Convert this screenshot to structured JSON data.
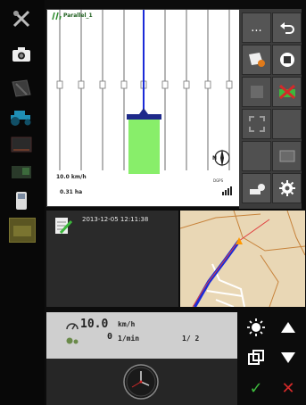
{
  "guidance": {
    "track_name": "Parallel_1",
    "speed": "10.0 km/h",
    "area": "0.31 ha",
    "gps_label": "DGPS",
    "compass_label": "N"
  },
  "job": {
    "timestamp": "2013-12-05 12:11:38"
  },
  "work": {
    "speed_value": "10.0",
    "speed_unit": "km/h",
    "rpm_value": "0",
    "rpm_unit": "1/min",
    "counter": "1/ 2"
  },
  "colors": {
    "guidance_line": "#1b2bd8",
    "worked_area": "#88ee6a",
    "implement": "#1e2a8a",
    "track_lines": "#6b6b6b",
    "confirm": "#3db83d",
    "cancel": "#d42a2a",
    "map_bg": "#e9d7b5",
    "map_path": "#2233dd"
  },
  "icons": {
    "left_toolbar": [
      "tools-icon",
      "camera-icon",
      "field-icon",
      "tractor-icon",
      "implement-icon",
      "coverage-icon",
      "terminal-icon",
      "folder-icon"
    ],
    "function_grid": [
      "more-icon",
      "back-icon",
      "add-field-icon",
      "record-stop-icon",
      "disabled-icon",
      "section-off-icon",
      "fullscreen-icon",
      "blank-icon",
      "blank-icon",
      "map-view-icon",
      "implement-settings-icon",
      "settings-gear-icon"
    ]
  },
  "controls": {
    "more_label": "...",
    "confirm_label": "✓",
    "cancel_label": "✕"
  }
}
